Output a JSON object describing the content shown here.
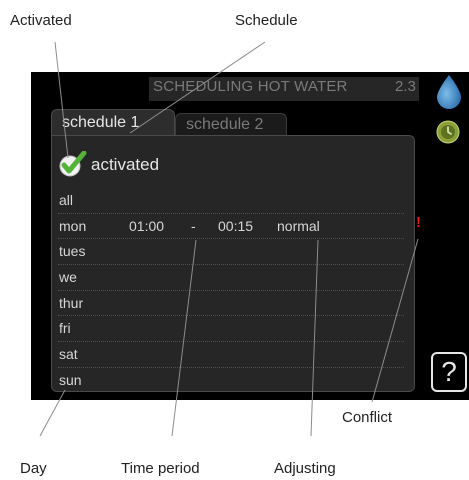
{
  "callouts": {
    "activated": "Activated",
    "schedule": "Schedule",
    "conflict": "Conflict",
    "day": "Day",
    "time_period": "Time period",
    "adjusting": "Adjusting"
  },
  "header": {
    "title": "SCHEDULING HOT WATER",
    "code": "2.3"
  },
  "tabs": [
    {
      "label": "schedule 1",
      "active": true
    },
    {
      "label": "schedule 2",
      "active": false
    }
  ],
  "activated_label": "activated",
  "days": [
    {
      "day": "all"
    },
    {
      "day": "mon",
      "start": "01:00",
      "dash": "-",
      "end": "00:15",
      "mode": "normal",
      "conflict": true
    },
    {
      "day": "tues"
    },
    {
      "day": "we"
    },
    {
      "day": "thur"
    },
    {
      "day": "fri"
    },
    {
      "day": "sat"
    },
    {
      "day": "sun"
    }
  ],
  "conflict_icon": "!",
  "help_label": "?",
  "colors": {
    "water_drop": "#3a83c4",
    "check_green": "#55b33a",
    "conflict_red": "#e01818"
  },
  "icons": [
    "water-drop-icon",
    "clock-icon",
    "checkmark-icon",
    "help-icon",
    "conflict-icon"
  ]
}
